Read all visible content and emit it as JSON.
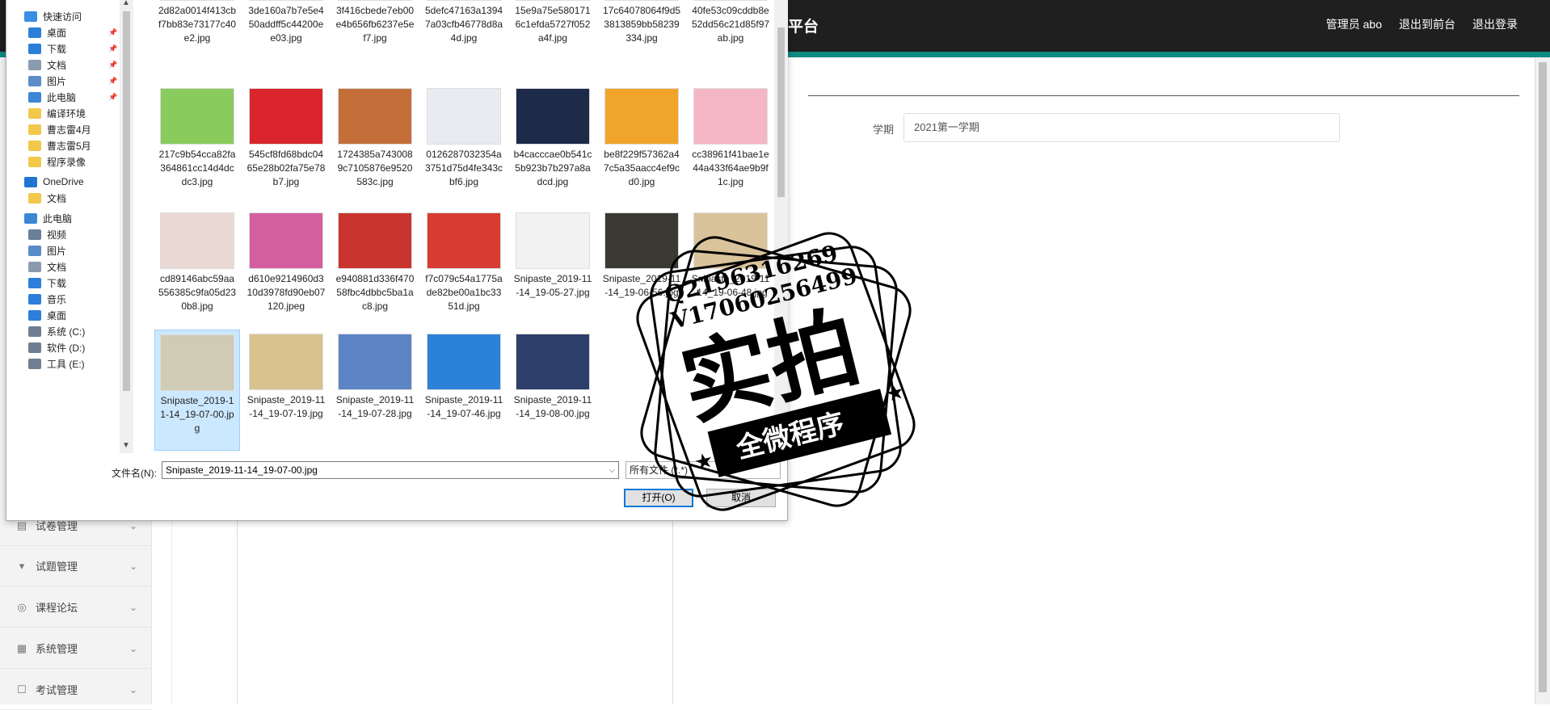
{
  "header": {
    "title": "平台",
    "links": [
      "管理员 abo",
      "退出到前台",
      "退出登录"
    ]
  },
  "sidebar": {
    "items": [
      {
        "label": "试卷管理",
        "icon": "paper-icon"
      },
      {
        "label": "试题管理",
        "icon": "question-icon"
      },
      {
        "label": "课程论坛",
        "icon": "forum-icon"
      },
      {
        "label": "系统管理",
        "icon": "system-icon"
      },
      {
        "label": "考试管理",
        "icon": "exam-icon"
      }
    ]
  },
  "form": {
    "term_label": "学期",
    "term_value": "2021第一学期"
  },
  "dialog": {
    "nav": [
      {
        "label": "快速访问",
        "icon": "star-icon",
        "color": "#3a8ee6"
      },
      {
        "label": "桌面",
        "icon": "desktop-icon",
        "color": "#2c7fd8",
        "pinned": true
      },
      {
        "label": "下载",
        "icon": "download-icon",
        "color": "#2c7fd8",
        "pinned": true
      },
      {
        "label": "文档",
        "icon": "document-icon",
        "color": "#8a9bb0",
        "pinned": true
      },
      {
        "label": "图片",
        "icon": "picture-icon",
        "color": "#5b8bc9",
        "pinned": true
      },
      {
        "label": "此电脑",
        "icon": "computer-icon",
        "color": "#3b87d6",
        "pinned": true
      },
      {
        "label": "编译环境",
        "icon": "folder-icon",
        "color": "#f2c84b"
      },
      {
        "label": "曹志雷4月",
        "icon": "folder-icon",
        "color": "#f2c84b"
      },
      {
        "label": "曹志雷5月",
        "icon": "folder-icon",
        "color": "#f2c84b"
      },
      {
        "label": "程序录像",
        "icon": "folder-icon",
        "color": "#f2c84b"
      },
      {
        "label": "OneDrive",
        "icon": "cloud-icon",
        "color": "#1f75d1"
      },
      {
        "label": "文档",
        "icon": "folder-icon",
        "color": "#f2c84b"
      },
      {
        "label": "此电脑",
        "icon": "computer-icon",
        "color": "#3b87d6"
      },
      {
        "label": "视频",
        "icon": "video-icon",
        "color": "#6a7f98"
      },
      {
        "label": "图片",
        "icon": "picture-icon",
        "color": "#5b8bc9"
      },
      {
        "label": "文档",
        "icon": "document-icon",
        "color": "#8a9bb0"
      },
      {
        "label": "下载",
        "icon": "download-icon",
        "color": "#2c7fd8"
      },
      {
        "label": "音乐",
        "icon": "music-icon",
        "color": "#2c7fd8"
      },
      {
        "label": "桌面",
        "icon": "desktop-icon",
        "color": "#2c7fd8"
      },
      {
        "label": "系统 (C:)",
        "icon": "drive-icon",
        "color": "#6f7f8f"
      },
      {
        "label": "软件 (D:)",
        "icon": "drive-icon",
        "color": "#6f7f8f"
      },
      {
        "label": "工具 (E:)",
        "icon": "drive-icon",
        "color": "#6f7f8f"
      }
    ],
    "files": [
      {
        "name": "2d82a0014f413cbf7bb83e73177c40e2.jpg",
        "color": "#f4c842"
      },
      {
        "name": "3de160a7b7e5e450addff5c44200ee03.jpg",
        "color": "#d8564e"
      },
      {
        "name": "3f416cbede7eb00e4b656fb6237e5ef7.jpg",
        "color": "#e98c4f"
      },
      {
        "name": "5defc47163a13947a03cfb46778d8a4d.jpg",
        "color": "#4e8cc4"
      },
      {
        "name": "15e9a75e5801716c1efda5727f052a4f.jpg",
        "color": "#1c3d8f"
      },
      {
        "name": "17c64078064f9d53813859bb58239334.jpg",
        "color": "#f3e2c7"
      },
      {
        "name": "40fe53c09cddb8e52dd56c21d85f97ab.jpg",
        "color": "#6fb5e3"
      },
      {
        "name": "217c9b54cca82fa364861cc14d4dcdc3.jpg",
        "color": "#8acb5e"
      },
      {
        "name": "545cf8fd68bdc0465e28b02fa75e78b7.jpg",
        "color": "#d9252b"
      },
      {
        "name": "1724385a7430089c7105876e9520583c.jpg",
        "color": "#c46f3a"
      },
      {
        "name": "0126287032354a3751d75d4fe343cbf6.jpg",
        "color": "#e8ecf0"
      },
      {
        "name": "b4cacccae0b541c5b923b7b297a8adcd.jpg",
        "color": "#1d2a4a"
      },
      {
        "name": "be8f229f57362a47c5a35aacc4ef9cd0.jpg",
        "color": "#f0a52a"
      },
      {
        "name": "cc38961f41bae1e44a433f64ae9b9f1c.jpg",
        "color": "#f4b6c5"
      },
      {
        "name": "cd89146abc59aa556385c9fa05d230b8.jpg",
        "color": "#e9d8d4"
      },
      {
        "name": "d610e9214960d310d3978fd90eb07120.jpeg",
        "color": "#d35fa0"
      },
      {
        "name": "e940881d336f47058fbc4dbbc5ba1ac8.jpg",
        "color": "#c9342f"
      },
      {
        "name": "f7c079c54a1775ade82be00a1bc3351d.jpg",
        "color": "#d73d32"
      },
      {
        "name": "Snipaste_2019-11-14_19-05-27.jpg",
        "color": "#f2f2f2"
      },
      {
        "name": "Snipaste_2019-11-14_19-06-56.jpg",
        "color": "#3a3a32"
      },
      {
        "name": "Snipaste_2019-11-14_19-06-48.jpg",
        "color": "#d9c39b"
      },
      {
        "name": "Snipaste_2019-11-14_19-07-00.jpg",
        "color": "#cfcbb4",
        "selected": true
      },
      {
        "name": "Snipaste_2019-11-14_19-07-19.jpg",
        "color": "#d8c28f"
      },
      {
        "name": "Snipaste_2019-11-14_19-07-28.jpg",
        "color": "#5d84c4"
      },
      {
        "name": "Snipaste_2019-11-14_19-07-46.jpg",
        "color": "#2b82d8"
      },
      {
        "name": "Snipaste_2019-11-14_19-08-00.jpg",
        "color": "#2e3f6b"
      }
    ],
    "filename_label": "文件名(N):",
    "filename_value": "Snipaste_2019-11-14_19-07-00.jpg",
    "filetype_value": "所有文件 (*.*)",
    "open_label": "打开(O)",
    "cancel_label": "取消"
  },
  "watermark": {
    "line1": "Q2196316269",
    "line2": "V17060256499",
    "main": "实拍",
    "ribbon": "全微程序"
  }
}
